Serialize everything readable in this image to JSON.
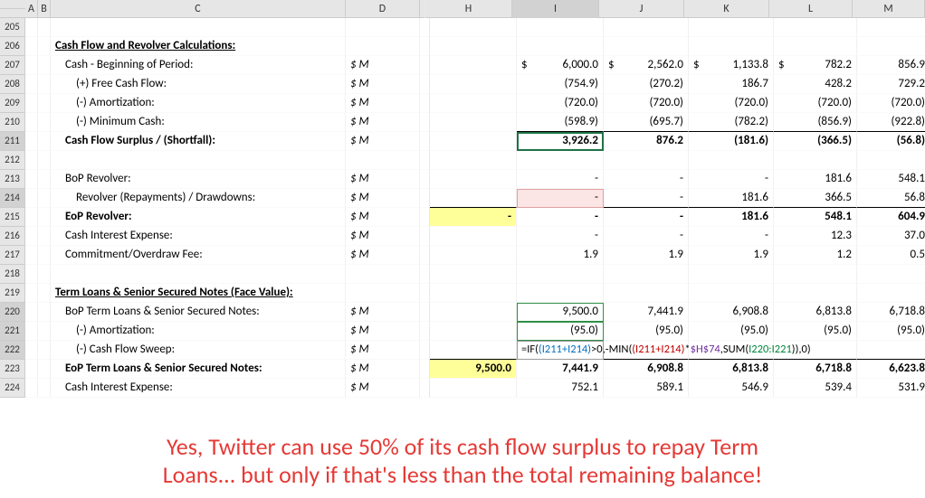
{
  "chart_data": {
    "type": "table",
    "title": "Cash Flow / Revolver / Term Loans schedule",
    "columns": [
      "I",
      "J",
      "K",
      "L",
      "M"
    ],
    "rows": {
      "Cash - Beginning of Period": [
        6000.0,
        2562.0,
        1133.8,
        782.2,
        856.9
      ],
      "(+) Free Cash Flow": [
        -754.9,
        -270.2,
        186.7,
        428.2,
        729.2
      ],
      "(-) Amortization": [
        -720.0,
        -720.0,
        -720.0,
        -720.0,
        -720.0
      ],
      "(-) Minimum Cash": [
        -598.9,
        -695.7,
        -782.2,
        -856.9,
        -922.8
      ],
      "Cash Flow Surplus / (Shortfall)": [
        3926.2,
        876.2,
        -181.6,
        -366.5,
        -56.8
      ],
      "BoP Revolver": [
        null,
        null,
        null,
        181.6,
        548.1
      ],
      "Revolver (Repayments) / Drawdowns": [
        null,
        null,
        181.6,
        366.5,
        56.8
      ],
      "EoP Revolver": [
        null,
        null,
        181.6,
        548.1,
        604.9
      ],
      "Cash Interest Expense (Revolver)": [
        null,
        null,
        null,
        12.3,
        37.0
      ],
      "Commitment/Overdraw Fee": [
        1.9,
        1.9,
        1.9,
        1.2,
        0.5
      ],
      "BoP Term Loans & Sr Secured Notes": [
        9500.0,
        7441.9,
        6908.8,
        6813.8,
        6718.8
      ],
      "(-) Amortization (TL)": [
        -95.0,
        -95.0,
        -95.0,
        -95.0,
        -95.0
      ],
      "EoP Term Loans & Sr Secured Notes": [
        7441.9,
        6908.8,
        6813.8,
        6718.8,
        6623.8
      ],
      "Cash Interest Expense (TL)": [
        752.1,
        589.1,
        546.9,
        539.4,
        531.9
      ]
    },
    "unit": "$ M",
    "H_values": {
      "EoP Revolver": "-",
      "EoP Term Loans & Sr Secured Notes": 9500.0
    }
  },
  "colHeaders": {
    "rh": "",
    "A": "A",
    "B": "B",
    "C": "C",
    "D": "D",
    "H": "H",
    "I": "I",
    "J": "J",
    "K": "K",
    "L": "L",
    "M": "M"
  },
  "rowHeaders": [
    "205",
    "206",
    "207",
    "208",
    "209",
    "210",
    "211",
    "212",
    "213",
    "214",
    "215",
    "216",
    "217",
    "218",
    "219",
    "220",
    "221",
    "222",
    "223",
    "224"
  ],
  "unit": "$ M",
  "dollar": "$",
  "labels": {
    "section1": "Cash Flow and Revolver Calculations:",
    "cashBop": "Cash - Beginning of Period:",
    "fcf": "(+) Free Cash Flow:",
    "amort": "(-) Amortization:",
    "minCash": "(-) Minimum Cash:",
    "surplus": "Cash Flow Surplus / (Shortfall):",
    "bopRev": "BoP Revolver:",
    "revRD": "Revolver (Repayments) / Drawdowns:",
    "eopRev": "EoP Revolver:",
    "cie": "Cash Interest Expense:",
    "commit": "Commitment/Overdraw Fee:",
    "section2": "Term Loans & Senior Secured Notes (Face Value):",
    "bopTL": "BoP Term Loans & Senior Secured Notes:",
    "amortTL": "(-) Amortization:",
    "sweep": "(-) Cash Flow Sweep:",
    "eopTL": "EoP Term Loans & Senior Secured Notes:",
    "cieTL": "Cash Interest Expense:"
  },
  "vals": {
    "r207": {
      "I": "6,000.0",
      "J": "2,562.0",
      "K": "1,133.8",
      "L": "782.2",
      "M": "856.9"
    },
    "r208": {
      "I": "(754.9)",
      "J": "(270.2)",
      "K": "186.7",
      "L": "428.2",
      "M": "729.2"
    },
    "r209": {
      "I": "(720.0)",
      "J": "(720.0)",
      "K": "(720.0)",
      "L": "(720.0)",
      "M": "(720.0)"
    },
    "r210": {
      "I": "(598.9)",
      "J": "(695.7)",
      "K": "(782.2)",
      "L": "(856.9)",
      "M": "(922.8)"
    },
    "r211": {
      "I": "3,926.2",
      "J": "876.2",
      "K": "(181.6)",
      "L": "(366.5)",
      "M": "(56.8)"
    },
    "r213": {
      "I": "-",
      "J": "-",
      "K": "-",
      "L": "181.6",
      "M": "548.1"
    },
    "r214": {
      "I": "-",
      "J": "-",
      "K": "181.6",
      "L": "366.5",
      "M": "56.8"
    },
    "r215": {
      "H": "-",
      "I": "-",
      "J": "-",
      "K": "181.6",
      "L": "548.1",
      "M": "604.9"
    },
    "r216": {
      "I": "-",
      "J": "-",
      "K": "-",
      "L": "12.3",
      "M": "37.0"
    },
    "r217": {
      "I": "1.9",
      "J": "1.9",
      "K": "1.9",
      "L": "1.2",
      "M": "0.5"
    },
    "r220": {
      "I": "9,500.0",
      "J": "7,441.9",
      "K": "6,908.8",
      "L": "6,813.8",
      "M": "6,718.8"
    },
    "r221": {
      "I": "(95.0)",
      "J": "(95.0)",
      "K": "(95.0)",
      "L": "(95.0)",
      "M": "(95.0)"
    },
    "r223": {
      "H": "9,500.0",
      "I": "7,441.9",
      "J": "6,908.8",
      "K": "6,813.8",
      "L": "6,718.8",
      "M": "6,623.8"
    },
    "r224": {
      "I": "752.1",
      "J": "589.1",
      "K": "546.9",
      "L": "539.4",
      "M": "531.9"
    }
  },
  "formula": {
    "p1": "=IF(",
    "p2": "(I211+I214)",
    "p3": ">0,-",
    "p4": "MIN(",
    "p5": "(I211+I214)",
    "p6": "*",
    "p7": "$H$74",
    "p8": ",SUM(",
    "p9": "I220:I221",
    "p10": ")",
    "p11": "),0)"
  },
  "annotation_line1": "Yes, Twitter can use 50% of its cash flow surplus to repay Term",
  "annotation_line2": "Loans... but only if that's less than the total remaining balance!"
}
